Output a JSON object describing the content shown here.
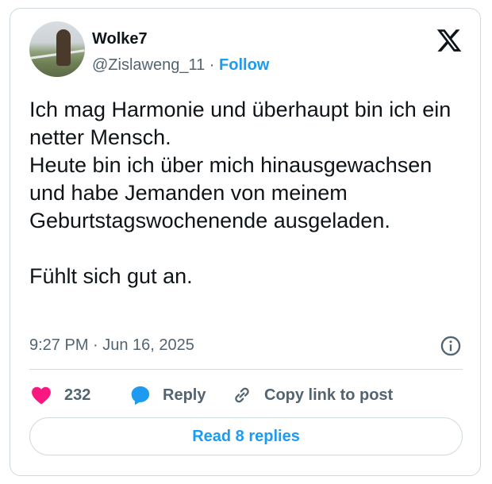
{
  "author": {
    "name": "Wolke7",
    "handle": "@Zislaweng_11",
    "separator": "·",
    "follow_label": "Follow"
  },
  "tweet": {
    "text": "Ich mag Harmonie und überhaupt bin ich ein netter Mensch.\nHeute bin ich über mich hinausgewachsen und habe Jemanden von meinem Geburtstagswochenende ausgeladen.\n\nFühlt sich gut an.",
    "timestamp": "9:27 PM · Jun 16, 2025"
  },
  "actions": {
    "like_count": "232",
    "reply_label": "Reply",
    "copy_label": "Copy link to post"
  },
  "read_replies_label": "Read 8 replies",
  "colors": {
    "accent": "#1d9bf0",
    "like": "#f91880",
    "text": "#0f1419",
    "muted": "#536471",
    "border": "#cfd9de"
  },
  "icons": [
    "x-logo-icon",
    "info-icon",
    "heart-icon",
    "reply-bubble-icon",
    "link-icon"
  ]
}
